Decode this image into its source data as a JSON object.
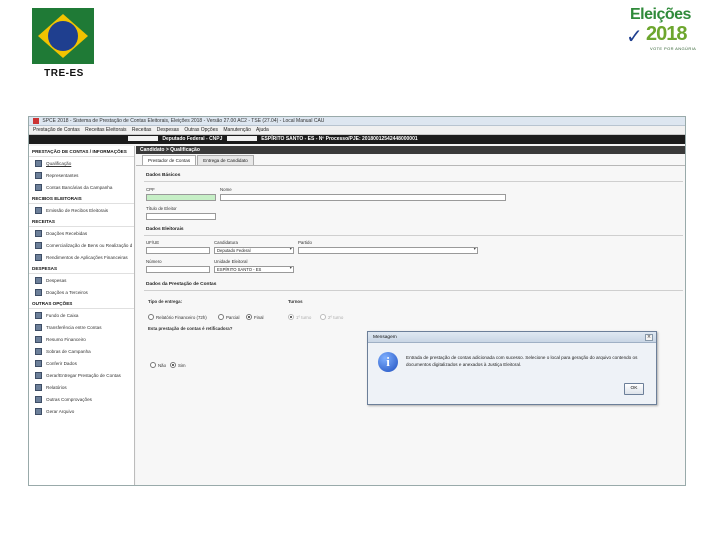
{
  "slide": {
    "left_logo_text": "TRE-ES",
    "right_logo_title": "Eleições",
    "right_logo_year": "2018",
    "right_logo_tagline": "VOTE POR ANGÚRIA"
  },
  "window": {
    "title": "SPCE 2018 - Sistema de Prestação de Contas Eleitorais, Eleições 2018 - Versão 27.00 AC2 - TSE (27.04) - Local Manual CAU",
    "menus": [
      "Prestação de Contas",
      "Receitas Eleitorais",
      "Receitas",
      "Despesas",
      "Outras Opções",
      "Manutenção",
      "Ajuda"
    ],
    "candidate_bar": {
      "office": "Deputado Federal - CNPJ",
      "state": "ESPÍRITO SANTO - ES - Nº Processo/PJE: 20180012542448000001"
    }
  },
  "sidebar": {
    "header": "PRESTAÇÃO DE CONTAS / INFORMAÇÕES",
    "groups": [
      {
        "title": "",
        "items": [
          "Qualificação",
          "Representantes",
          "Contas Bancárias da Campanha"
        ]
      },
      {
        "title": "RECIBOS ELEITORAIS",
        "items": [
          "Emissão de Recibos Eleitorais"
        ]
      },
      {
        "title": "RECEITAS",
        "items": [
          "Doações Recebidas",
          "Comercialização de Bens ou Realização d",
          "Rendimentos de Aplicações Financeiras"
        ]
      },
      {
        "title": "DESPESAS",
        "items": [
          "Despesas",
          "Doações a Terceiros"
        ]
      },
      {
        "title": "OUTRAS OPÇÕES",
        "items": [
          "Fundo de Caixa",
          "Transferência entre Contas",
          "Resumo Financeiro",
          "Sobras de Campanha",
          "Conferir Dados",
          "Gerar/Entregar Prestação de Contas",
          "Relatórios",
          "Outras Comprovações",
          "Gerar Arquivo"
        ]
      }
    ]
  },
  "main": {
    "section_title": "Candidato > Qualificação",
    "tabs": [
      "Prestador de Contas",
      "Entrega de Candidato"
    ],
    "dados_basicos": {
      "title": "Dados Básicos",
      "cpf_label": "CPF",
      "nome_label": "Nome",
      "titulo_label": "Título de Eleitor"
    },
    "dados_eleitorais": {
      "title": "Dados Eleitorais",
      "uf_label": "UF/UE",
      "candidatura_label": "Candidatura",
      "candidatura_value": "Deputado Federal",
      "partido_label": "Partido",
      "numero_label": "Número",
      "unidade_label": "Unidade Eleitoral",
      "unidade_value": "ESPÍRITO SANTO - ES"
    },
    "dados_prestacao": {
      "title": "Dados da Prestação de Contas",
      "tipo_label": "Tipo de entrega:",
      "turnos_label": "Turnos",
      "tipo_options": [
        "Relatório Financeiro (72h)",
        "Parcial",
        "Final"
      ],
      "tipo_selected": 2,
      "turno_options": [
        "1º turno",
        "2º turno"
      ],
      "retificadora_label": "Esta prestação de contas é retificadora?",
      "retificadora_options": [
        "Não",
        "Sim"
      ],
      "retificadora_selected": 1
    }
  },
  "dialog": {
    "title": "Mensagem",
    "message": "Entrada de prestação de contas adicionada com sucesso. Selecione o local para geração do arquivo contendo os documentos digitalizados e anexados à Justiça Eleitoral.",
    "ok_label": "OK"
  }
}
